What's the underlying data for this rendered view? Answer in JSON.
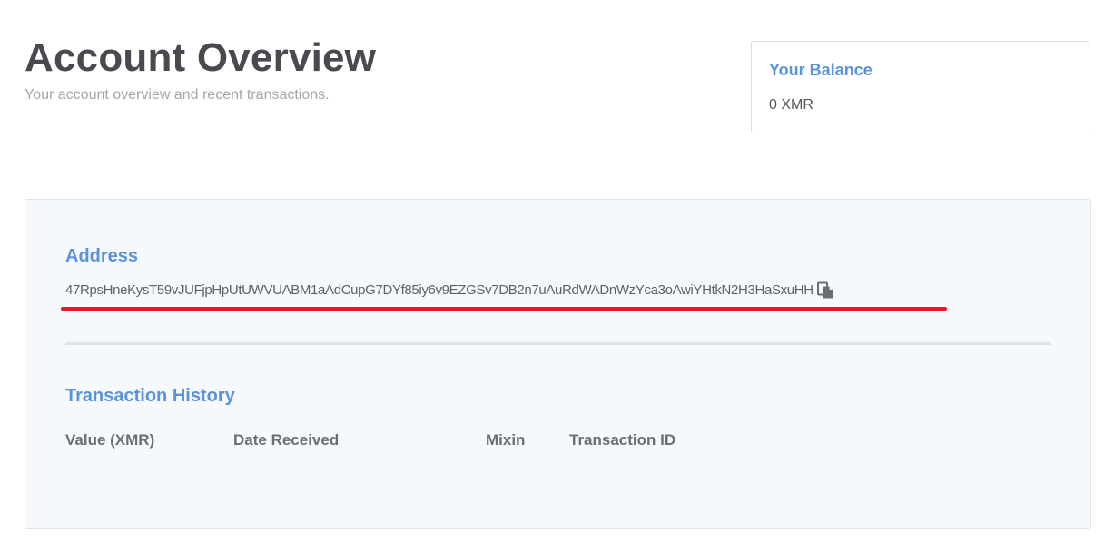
{
  "header": {
    "title": "Account Overview",
    "subtitle": "Your account overview and recent transactions."
  },
  "balance": {
    "title": "Your Balance",
    "value": "0 XMR"
  },
  "address": {
    "title": "Address",
    "value": "47RpsHneKysT59vJUFjpHpUtUWVUABM1aAdCupG7DYf85iy6v9EZGSv7DB2n7uAuRdWADnWzYca3oAwiYHtkN2H3HaSxuHH",
    "copy_icon": "copy-icon"
  },
  "transactions": {
    "title": "Transaction History",
    "columns": [
      "Value (XMR)",
      "Date Received",
      "Mixin",
      "Transaction ID"
    ],
    "rows": []
  },
  "colors": {
    "accent": "#5a93da",
    "title_text": "#484a4f",
    "annotation_underline": "#e3182d",
    "card_background": "#f6f9fb"
  }
}
